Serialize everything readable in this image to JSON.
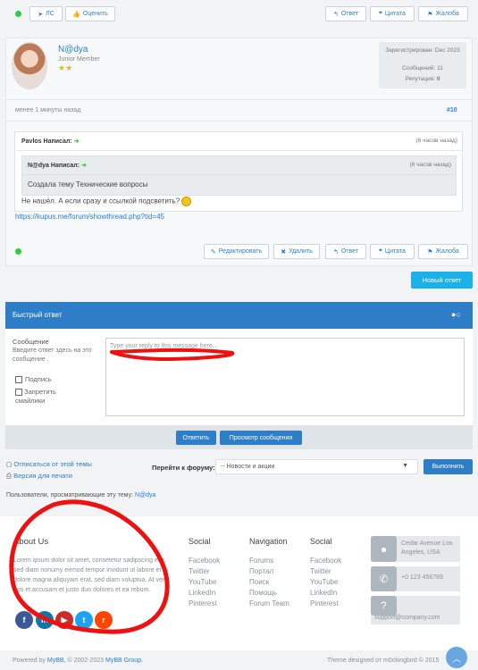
{
  "top_bar": {
    "pm_label": "ЛС",
    "rate_label": "Оценить",
    "reply_label": "Ответ",
    "quote_label": "Цитата",
    "report_label": "Жалоба"
  },
  "post": {
    "username": "N@dya",
    "user_title": "Junior Member",
    "registered": "Зарегистрирован: Dec 2023",
    "messages": "Сообщений: 11",
    "reputation_label": "Репутация:",
    "reputation_value": "0",
    "time": "менее 1 минуты назад",
    "post_number": "#10",
    "quote_outer_author": "Pavlos Написал:",
    "quote_outer_time": "(6 часов назад)",
    "quote_inner_author": "N@dya Написал:",
    "quote_inner_time": "(6 часов назад)",
    "quote_inner_text": "Создала тему Технические вопросы",
    "quote_outer_text": "Не нашёл. А если сразу и ссылкой подсветить?",
    "link": "https://kupus.me/forum/showthread.php?tid=45",
    "edit_label": "Редактировать",
    "delete_label": "Удалить",
    "reply_label": "Ответ",
    "quote_label": "Цитата",
    "report_label": "Жалоба"
  },
  "new_reply_label": "Новый ответ",
  "quick_reply": {
    "title": "Быстрый ответ",
    "message_label": "Сообщение",
    "message_hint": "Введите ответ здесь на это сообщение .",
    "signature_label": "Подпись",
    "disable_smilies_label": "Запретить смайлики",
    "placeholder": "Type your reply to this message here...",
    "submit_label": "Ответить",
    "preview_label": "Просмотр сообщения"
  },
  "thread_tools": {
    "unsubscribe": "Отписаться от этой темы",
    "print": "Версия для печати"
  },
  "forum_jump": {
    "label": "Перейти к форуму:",
    "selected": "-- Новости и акции",
    "go_label": "Выполнить"
  },
  "viewing": {
    "label": "Пользователи, просматривающие эту тему:",
    "user": "N@dya"
  },
  "footer": {
    "about_title": "About Us",
    "about_text": "Lorem ipsum dolor sit amet, consetetur sadipscing elitr, sed diam nonumy eirmod tempor invidunt ut labore et dolore magna aliquyam erat, sed diam voluptua. At vero eos et accusam et justo duo dolores et ea rebum.",
    "col1_title": "Social",
    "col1": [
      "Facebook",
      "Twitter",
      "YouTube",
      "LinkedIn",
      "Pinterest"
    ],
    "col2_title": "Navigation",
    "col2": [
      "Forums",
      "Портал",
      "Поиск",
      "Помощь",
      "Forum Team"
    ],
    "col3_title": "Social",
    "col3": [
      "Facebook",
      "Twitter",
      "YouTube",
      "LinkedIn",
      "Pinterest"
    ],
    "address": "Cedar Avenue Los Angeles, USA",
    "phone": "+0 123 456789",
    "email": "support@company.com",
    "powered": "Powered by",
    "mybb": "MyBB",
    "copyright": ", © 2002-2023",
    "mybb_group": "MyBB Group.",
    "theme": "Theme designed от m0ckingbird © 2015"
  },
  "colors": {
    "accent": "#2a7fd4",
    "header_bar": "#2d7dc7",
    "annotation_red": "#ee1111"
  }
}
